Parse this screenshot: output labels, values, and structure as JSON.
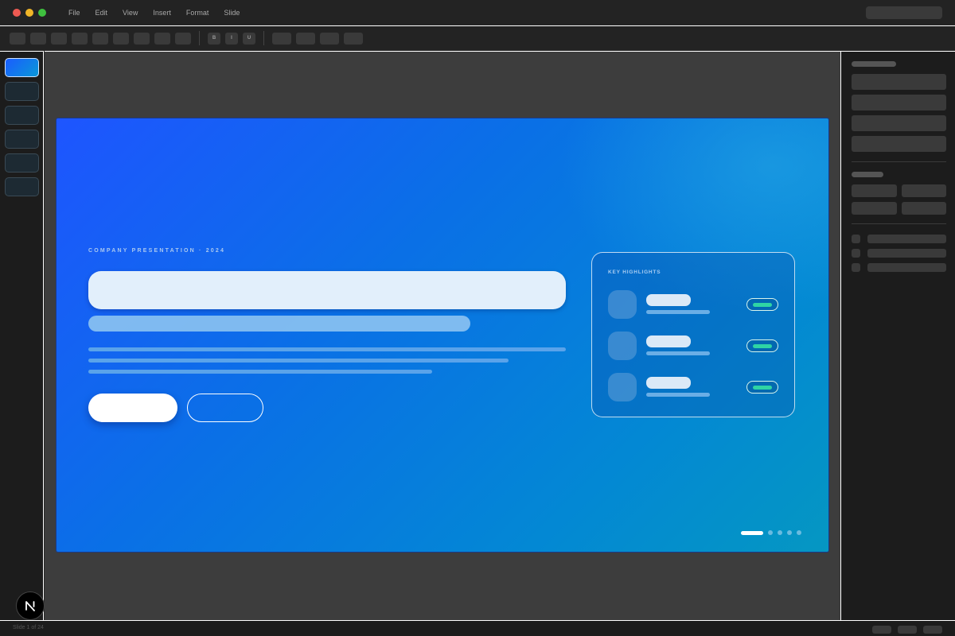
{
  "app": {
    "menu": [
      "File",
      "Edit",
      "View",
      "Insert",
      "Format",
      "Slide"
    ]
  },
  "toolbar": {
    "bold_label": "B",
    "italic_label": "I",
    "underline_label": "U"
  },
  "slide": {
    "kicker": "COMPANY PRESENTATION · 2024",
    "card_title": "KEY HIGHLIGHTS",
    "highlight_rows": 3,
    "pagination_total": 5,
    "pagination_active": 1
  },
  "thumbnails": {
    "count": 6,
    "active": 1
  },
  "status": {
    "slide_counter": "Slide 1 of 24"
  },
  "fab": {
    "logo_letter": "N"
  },
  "colors": {
    "accent": "#1e55ff",
    "badge": "#2fd4a4",
    "slide_gradient_end": "#0597c2"
  }
}
